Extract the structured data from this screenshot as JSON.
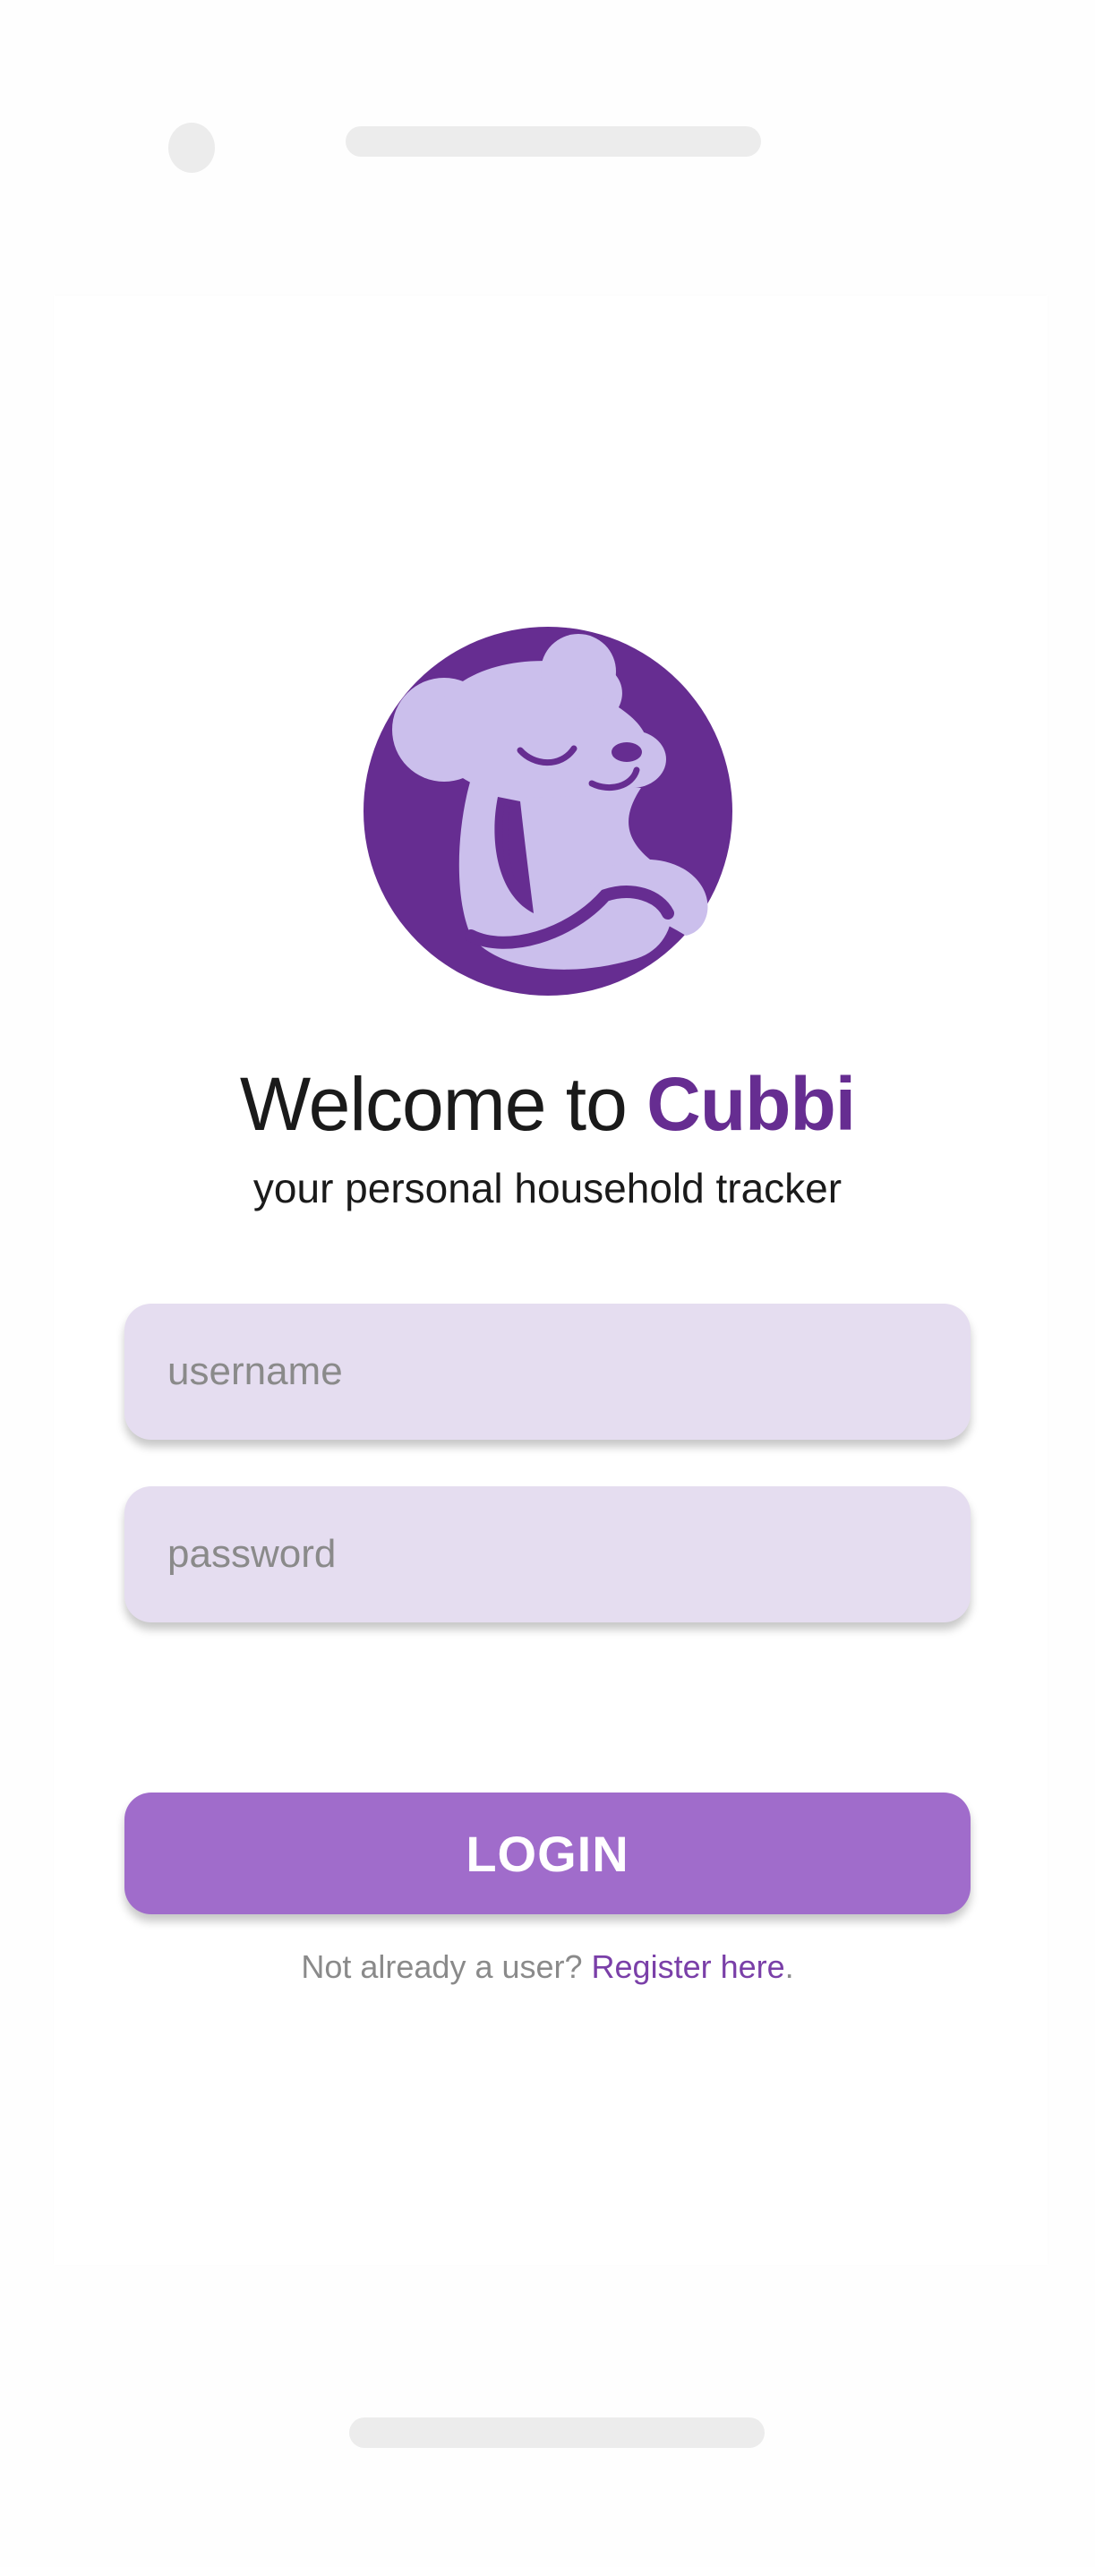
{
  "app": {
    "welcome_prefix": "Welcome to ",
    "brand_name": "Cubbi",
    "tagline": "your personal household tracker"
  },
  "form": {
    "username_placeholder": "username",
    "password_placeholder": "password",
    "login_label": "LOGIN"
  },
  "register": {
    "prompt": "Not already a user? ",
    "link_label": "Register here",
    "suffix": "."
  },
  "icons": {
    "logo": "teddy-bear-logo-icon"
  },
  "colors": {
    "brand": "#662d91",
    "logo_bear": "#cbbfec",
    "field_bg": "#e5ddf0",
    "button_bg": "#a06ccb",
    "link": "#7a3fa8"
  }
}
